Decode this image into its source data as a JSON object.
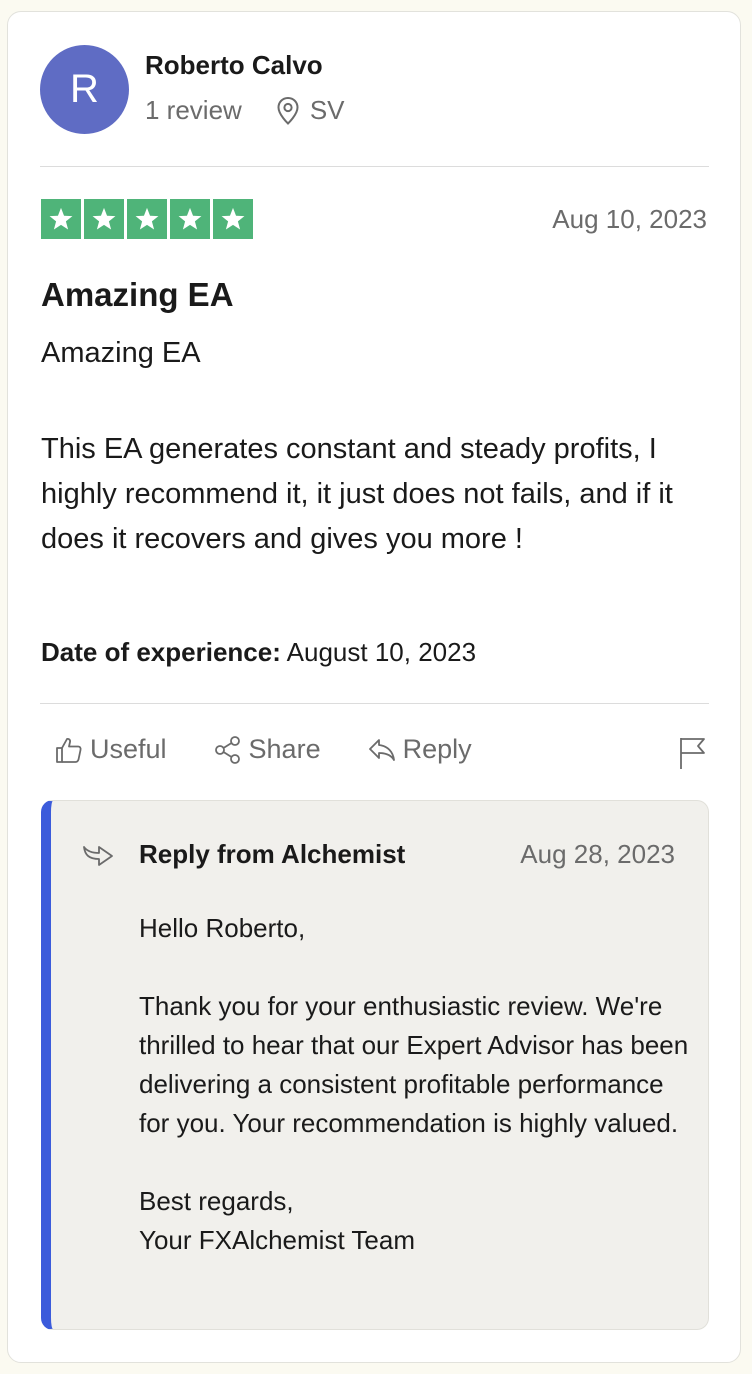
{
  "reviewer": {
    "initial": "R",
    "name": "Roberto Calvo",
    "reviews_count": "1 review",
    "location": "SV",
    "avatar_color": "#5f6cc4"
  },
  "review": {
    "rating": 5,
    "star_color": "#4fb479",
    "date": "Aug 10, 2023",
    "title": "Amazing EA",
    "body_first": "Amazing EA",
    "body": "This EA generates constant and steady profits, I highly recommend it, it just does not fails, and if it does it recovers and gives you more !",
    "experience_label": "Date of experience:",
    "experience_date": "August 10, 2023"
  },
  "actions": {
    "useful": "Useful",
    "share": "Share",
    "reply": "Reply"
  },
  "reply": {
    "from": "Reply from Alchemist",
    "date": "Aug 28, 2023",
    "accent_color": "#3b5bdb",
    "greeting": "Hello Roberto,",
    "message": "Thank you for your enthusiastic review. We're thrilled to hear that our Expert Advisor has been delivering a consistent profitable performance for you. Your recommendation is highly valued.",
    "closing": "Best regards,",
    "signature": "Your FXAlchemist Team"
  },
  "icons": {
    "location": "location-pin-icon",
    "star": "star-icon",
    "useful": "thumbs-up-icon",
    "share": "share-icon",
    "reply": "reply-arrow-icon",
    "flag": "flag-icon",
    "reply_thread": "reply-thread-icon"
  }
}
